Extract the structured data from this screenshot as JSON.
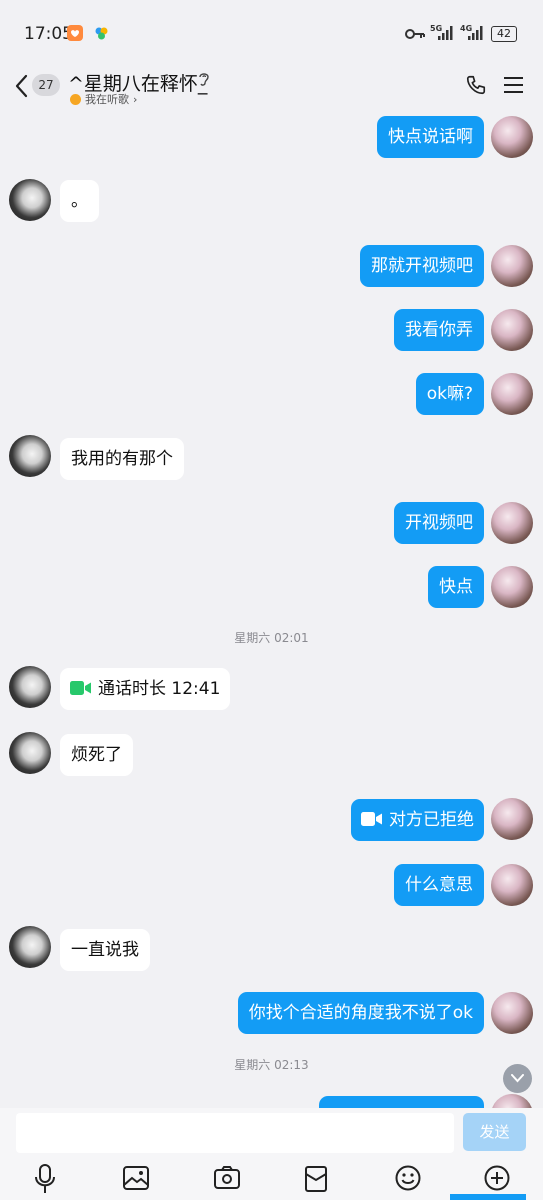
{
  "status_bar": {
    "time": "17:05",
    "signal_1": "5G",
    "signal_2": "4G",
    "battery": "42"
  },
  "header": {
    "unread_count": "27",
    "title": "^星期八在释怀_",
    "subtitle": "我在听歌"
  },
  "messages": [
    {
      "side": "me",
      "text": "快点说话啊"
    },
    {
      "side": "other",
      "text": "。"
    },
    {
      "side": "me",
      "text": "那就开视频吧"
    },
    {
      "side": "me",
      "text": "我看你弄"
    },
    {
      "side": "me",
      "text": "ok嘛?"
    },
    {
      "side": "other",
      "text": "我用的有那个"
    },
    {
      "side": "me",
      "text": "开视频吧"
    },
    {
      "side": "me",
      "text": "快点"
    },
    {
      "type": "timestamp",
      "text": "星期六 02:01"
    },
    {
      "side": "other",
      "type": "video-call",
      "text": "通话时长 12:41"
    },
    {
      "side": "other",
      "text": "烦死了"
    },
    {
      "side": "me",
      "type": "video-call",
      "text": "对方已拒绝"
    },
    {
      "side": "me",
      "text": "什么意思"
    },
    {
      "side": "other",
      "text": "一直说我"
    },
    {
      "side": "me",
      "text": "你找个合适的角度我不说了ok"
    },
    {
      "type": "timestamp",
      "text": "星期六 02:13"
    }
  ],
  "input_bar": {
    "placeholder": "",
    "send_label": "发送"
  },
  "toolbar": [
    "voice-icon",
    "image-icon",
    "camera-icon",
    "red-packet-icon",
    "emoji-icon",
    "plus-icon"
  ],
  "colors": {
    "my_bubble": "#139cf5",
    "call_icon": "#27c86b",
    "send_disabled": "#a5d3f7"
  }
}
